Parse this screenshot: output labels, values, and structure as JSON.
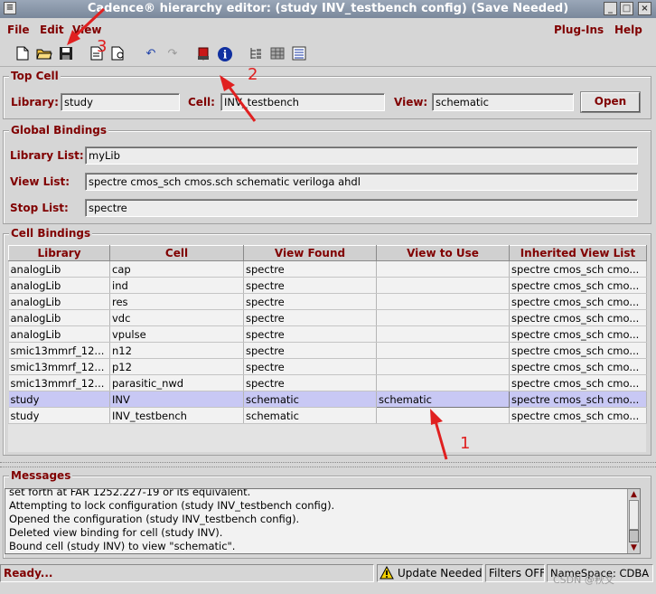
{
  "window": {
    "title": "Cadence® hierarchy editor: (study INV_testbench config) (Save Needed)"
  },
  "menubar": {
    "left": [
      "File",
      "Edit",
      "View"
    ],
    "right": [
      "Plug-Ins",
      "Help"
    ]
  },
  "toolbar": {
    "icons": [
      "new-icon",
      "open-folder-icon",
      "save-icon",
      "page-icon",
      "page-settings-icon",
      "undo-icon",
      "redo-icon",
      "update-icon",
      "info-icon",
      "tree-view-icon",
      "table-view-icon",
      "properties-icon"
    ]
  },
  "top_cell": {
    "title": "Top Cell",
    "library_label": "Library:",
    "library_value": "study",
    "cell_label": "Cell:",
    "cell_value": "INV_testbench",
    "view_label": "View:",
    "view_value": "schematic",
    "open_button": "Open"
  },
  "global_bindings": {
    "title": "Global Bindings",
    "library_list_label": "Library List:",
    "library_list_value": "myLib",
    "view_list_label": "View List:",
    "view_list_value": "spectre cmos_sch cmos.sch schematic veriloga ahdl",
    "stop_list_label": "Stop List:",
    "stop_list_value": "spectre"
  },
  "cell_bindings": {
    "title": "Cell Bindings",
    "columns": [
      "Library",
      "Cell",
      "View Found",
      "View to Use",
      "Inherited View List"
    ],
    "rows": [
      [
        "analogLib",
        "cap",
        "spectre",
        "",
        "spectre cmos_sch cmo..."
      ],
      [
        "analogLib",
        "ind",
        "spectre",
        "",
        "spectre cmos_sch cmo..."
      ],
      [
        "analogLib",
        "res",
        "spectre",
        "",
        "spectre cmos_sch cmo..."
      ],
      [
        "analogLib",
        "vdc",
        "spectre",
        "",
        "spectre cmos_sch cmo..."
      ],
      [
        "analogLib",
        "vpulse",
        "spectre",
        "",
        "spectre cmos_sch cmo..."
      ],
      [
        "smic13mmrf_12...",
        "n12",
        "spectre",
        "",
        "spectre cmos_sch cmo..."
      ],
      [
        "smic13mmrf_12...",
        "p12",
        "spectre",
        "",
        "spectre cmos_sch cmo..."
      ],
      [
        "smic13mmrf_12...",
        "parasitic_nwd",
        "spectre",
        "",
        "spectre cmos_sch cmo..."
      ],
      [
        "study",
        "INV",
        "schematic",
        "schematic",
        "spectre cmos_sch cmo..."
      ],
      [
        "study",
        "INV_testbench",
        "schematic",
        "",
        "spectre cmos_sch cmo..."
      ]
    ],
    "selected_row": 8
  },
  "messages": {
    "title": "Messages",
    "lines": [
      "set forth at FAR 1252.227-19 or its equivalent.",
      "Attempting to lock configuration (study INV_testbench config).",
      "Opened the configuration (study INV_testbench config).",
      "Deleted view binding for cell (study INV).",
      "Bound cell (study INV) to view \"schematic\"."
    ]
  },
  "status": {
    "ready": "Ready...",
    "update": "Update Needed",
    "filters": "Filters OFF",
    "namespace": "NameSpace: CDBA",
    "watermark": "CSDN @秋文"
  },
  "annotations": [
    "1",
    "2",
    "3"
  ],
  "colors": {
    "accent_text": "#800000",
    "selected_row": "#c8c8f4",
    "annotation": "#e02020"
  }
}
